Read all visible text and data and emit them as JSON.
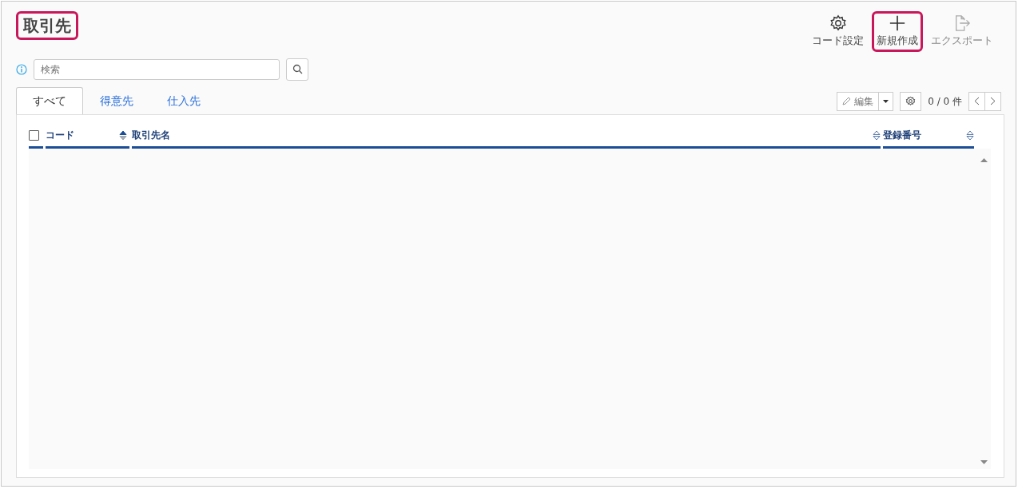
{
  "page": {
    "title": "取引先",
    "title_highlighted": true
  },
  "toolbar": [
    {
      "kind": "gear",
      "label": "コード設定",
      "disabled": false,
      "highlighted": false
    },
    {
      "kind": "plus",
      "label": "新規作成",
      "disabled": false,
      "highlighted": true
    },
    {
      "kind": "export",
      "label": "エクスポート",
      "disabled": true,
      "highlighted": false
    }
  ],
  "search": {
    "placeholder": "検索"
  },
  "tabs": [
    {
      "label": "すべて",
      "selected": true
    },
    {
      "label": "得意先",
      "selected": false
    },
    {
      "label": "仕入先",
      "selected": false
    }
  ],
  "actions": {
    "edit_label": "編集",
    "count": "0 / 0 件"
  },
  "table": {
    "select_all_checked": false,
    "columns": [
      {
        "label": "コード",
        "sorted_ascending": true
      },
      {
        "label": "取引先名",
        "sorted_ascending": false
      },
      {
        "label": "登録番号",
        "sorted_ascending": false
      }
    ]
  }
}
